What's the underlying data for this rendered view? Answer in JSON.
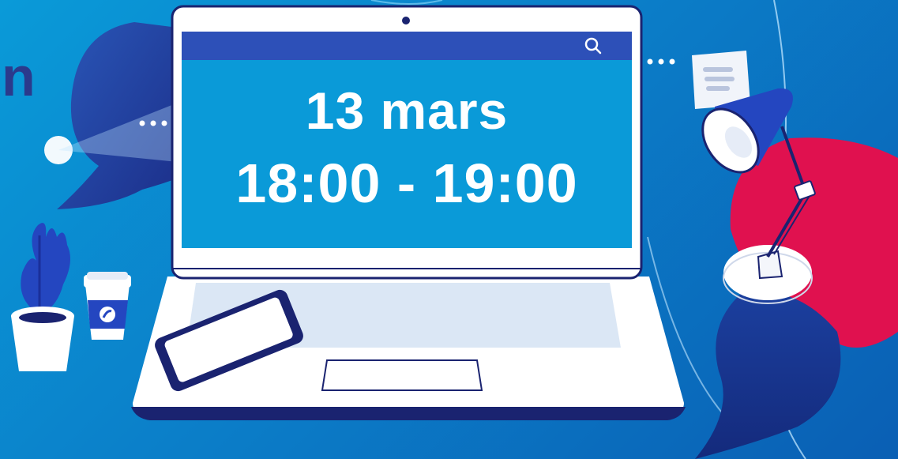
{
  "banner": {
    "partial_text": "n",
    "date": "13 mars",
    "time": "18:00 - 19:00"
  },
  "icons": {
    "search": "search-icon",
    "ellipsis": "ellipsis-icon",
    "note": "note-icon",
    "lamp": "desk-lamp-icon",
    "plant": "potted-plant-icon",
    "cup": "coffee-cup-icon",
    "phone": "smartphone-icon",
    "laptop": "laptop-icon"
  },
  "colors": {
    "background": "#0a8fd2",
    "screen": "#0a9ad8",
    "screen_bar": "#2d50b8",
    "accent_red": "#e0114f",
    "navy": "#1a2370",
    "lamp_blue": "#2446c0"
  }
}
